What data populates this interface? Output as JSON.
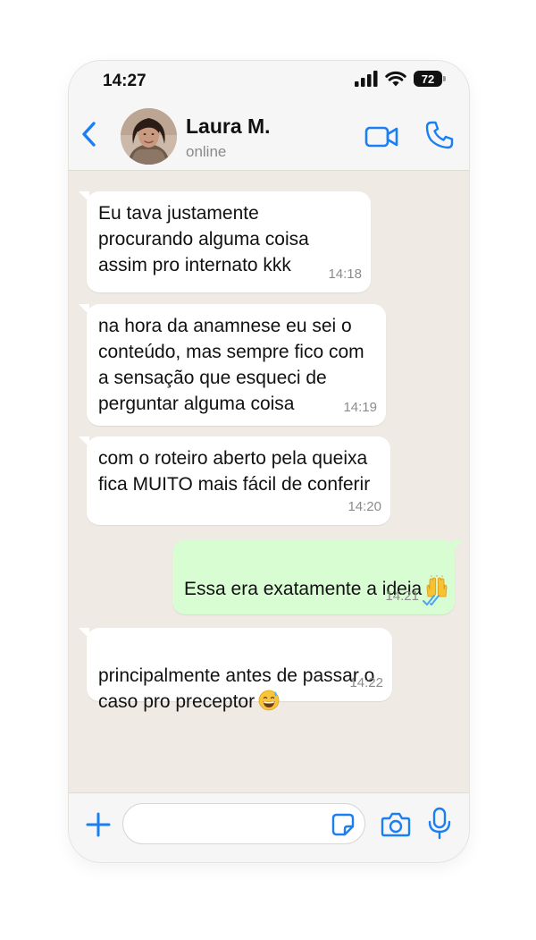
{
  "status_bar": {
    "time": "14:27",
    "battery": "72",
    "icons": [
      "signal-icon",
      "wifi-icon",
      "battery-icon"
    ]
  },
  "header": {
    "back_icon": "chevron-left-icon",
    "contact_name": "Laura M.",
    "contact_status": "online",
    "video_icon": "video-camera-icon",
    "call_icon": "phone-icon"
  },
  "messages": [
    {
      "direction": "in",
      "text": "Eu tava justamente\nprocurando alguma coisa\nassim pro internato kkk",
      "time": "14:18"
    },
    {
      "direction": "in",
      "text": "na hora da anamnese eu sei o\nconteúdo, mas sempre fico com\na sensação que esqueci de\nperguntar alguma coisa",
      "time": "14:19"
    },
    {
      "direction": "in",
      "text": "com o roteiro aberto pela queixa\nfica MUITO mais fácil de conferir",
      "time": "14:20"
    },
    {
      "direction": "out",
      "text": "Essa era exatamente a ideia",
      "emoji": "raising-hands-emoji",
      "time": "14:21",
      "status": "read"
    },
    {
      "direction": "in",
      "text": "principalmente antes de passar o\ncaso pro preceptor",
      "emoji": "grinning-sweat-emoji",
      "time": "14:22"
    }
  ],
  "input_bar": {
    "plus_icon": "plus-icon",
    "placeholder": "",
    "sticker_icon": "sticker-icon",
    "camera_icon": "camera-icon",
    "mic_icon": "microphone-icon"
  },
  "colors": {
    "accent": "#1a7ef5",
    "chat_background": "#efebe4",
    "incoming_bubble": "#ffffff",
    "outgoing_bubble": "#d9fdd3",
    "read_ticks": "#4fa4f0"
  }
}
